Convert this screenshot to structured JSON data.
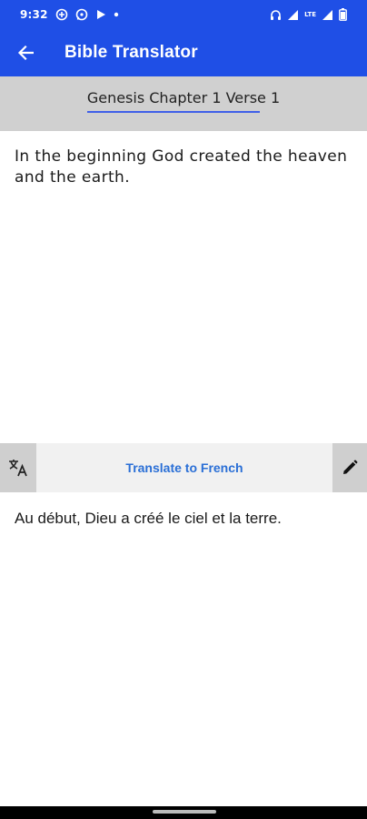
{
  "status_bar": {
    "time": "9:32",
    "notification_icons": [
      "data-saver-icon",
      "whatsapp-icon",
      "play-icon",
      "dot-icon"
    ],
    "system_icons": [
      "headset-icon",
      "signal-icon",
      "lte-signal-icon",
      "signal-icon",
      "battery-icon"
    ],
    "network_label": "LTE"
  },
  "app_bar": {
    "title": "Bible Translator",
    "back_icon": "arrow-back-icon"
  },
  "reference": {
    "label": "Genesis Chapter 1 Verse 1"
  },
  "source": {
    "text": "In the beginning God created the heaven and the earth."
  },
  "translate_bar": {
    "left_icon": "translate-icon",
    "button_label": "Translate to French",
    "right_icon": "edit-pencil-icon"
  },
  "translation": {
    "text": "Au début, Dieu a créé le ciel et la terre."
  },
  "colors": {
    "primary": "#1f4fe6",
    "reference_bar": "#d0d0d0",
    "translate_button_text": "#2a6fd6"
  }
}
